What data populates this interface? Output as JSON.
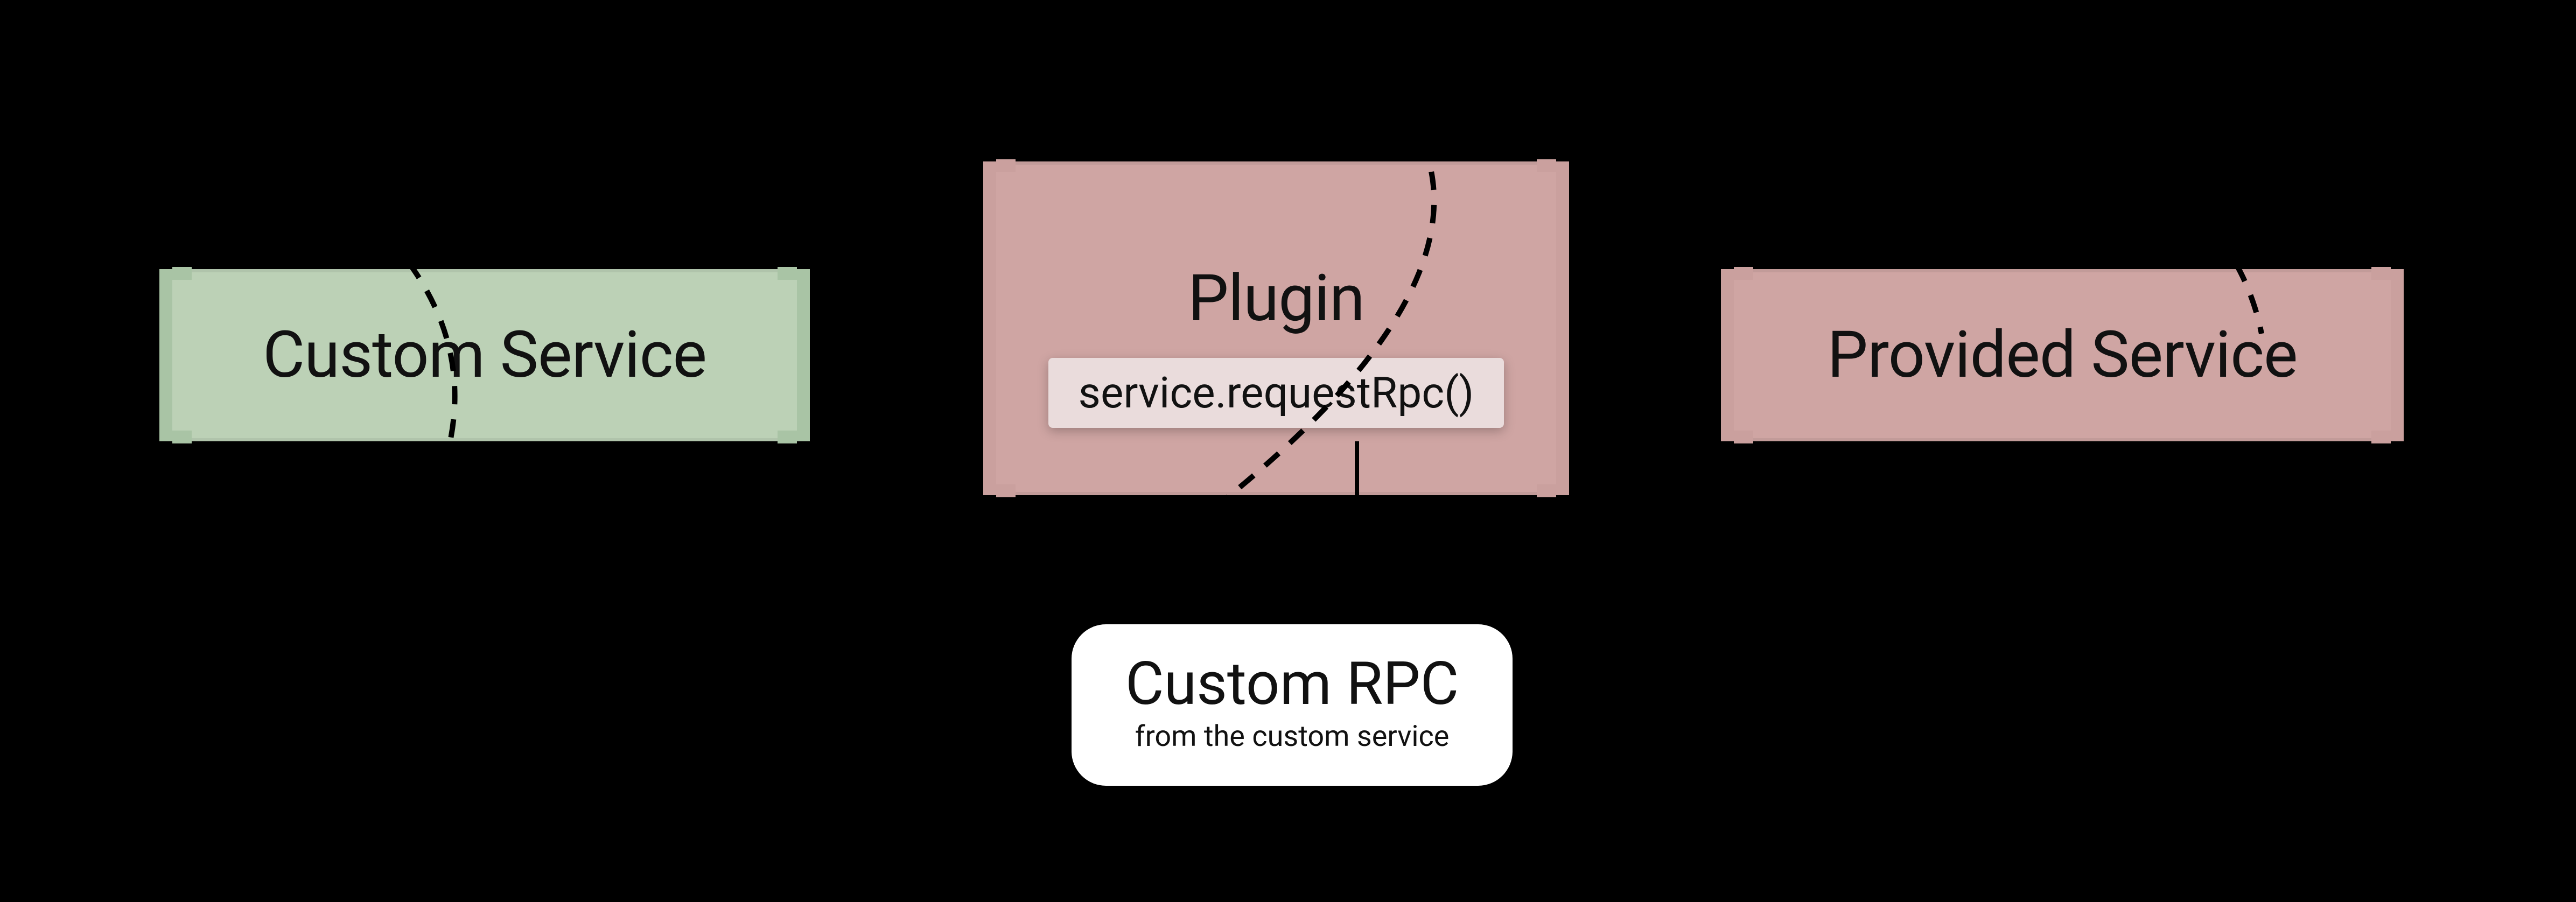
{
  "nodes": {
    "custom_service": {
      "title": "Custom Service"
    },
    "plugin": {
      "title": "Plugin",
      "call_label": "service.requestRpc()"
    },
    "provided_service": {
      "title": "Provided Service"
    }
  },
  "callout": {
    "title": "Custom RPC",
    "subtitle": "from the custom service"
  }
}
